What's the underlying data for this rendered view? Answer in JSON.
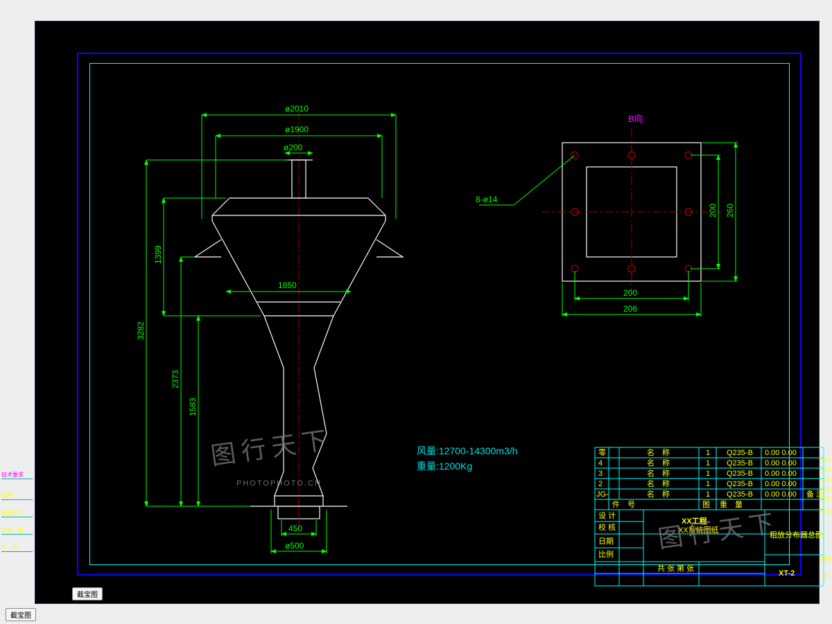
{
  "tab_label": "截宝图",
  "view_b_label": "B向",
  "notes": {
    "airflow_label": "风量:",
    "airflow_value": "12700-14300m3/h",
    "weight_label": "重量:",
    "weight_value": "1200Kg"
  },
  "main_dims": {
    "d2010": "ø2010",
    "d1900": "ø1900",
    "d200": "ø200",
    "w1850": "1850",
    "h1399": "1399",
    "h3282": "3282",
    "h2373": "2373",
    "h1583": "1583",
    "w450": "450",
    "d500": "ø500"
  },
  "detail_dims": {
    "hole": "8-ø14",
    "w200": "200",
    "w206": "206",
    "h200": "200",
    "h260": "260"
  },
  "title_block": {
    "project": "XX工程",
    "system": "XX系统图纸",
    "drawing_title": "粗放分布器总图",
    "drawing_no": "XT-2",
    "col_id": "号",
    "col_name": "名　称",
    "col_qty": "1",
    "material": "Q235-B",
    "dim_col": "0.00 0.00",
    "col_remark": "备 注",
    "row_labels": [
      "零",
      "4",
      "3",
      "2",
      "JG-"
    ],
    "bottom_row": "件　号",
    "bottom_row2": "重　量",
    "bottom_row3": "图",
    "rev": "校 核",
    "drawn": "设 计",
    "date": "日期",
    "scale": "比例",
    "sheet": "共 张 第 张"
  },
  "watermark": "图行天下",
  "watermark_url": "PHOTOPHOTO.CN"
}
